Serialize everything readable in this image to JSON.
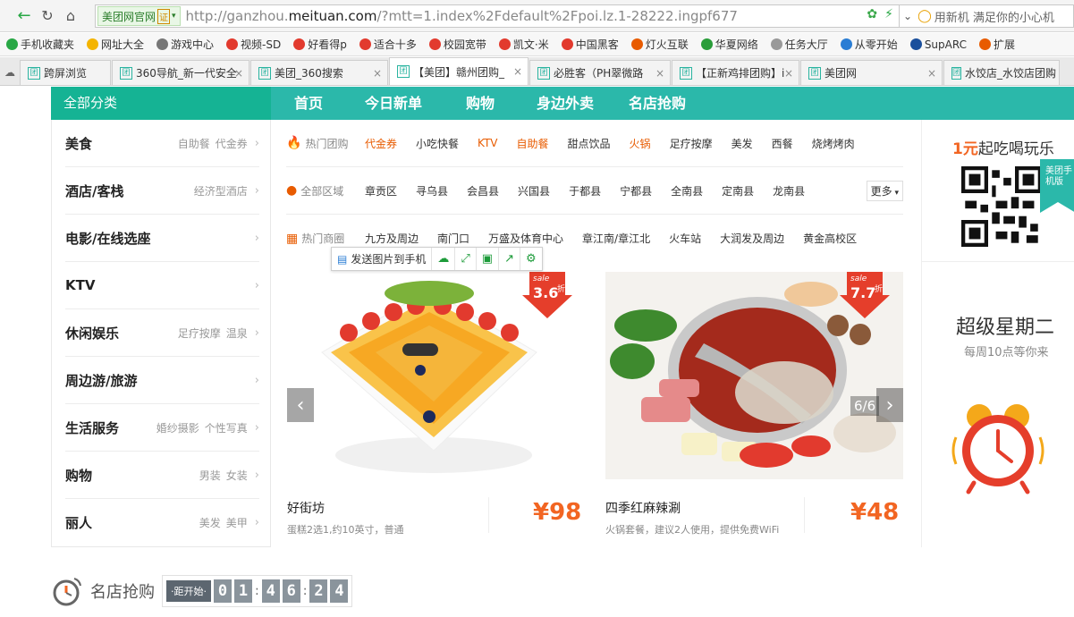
{
  "browser": {
    "site_badge": "美团网官网",
    "verify_badge": "证",
    "url_prefix": "http://ganzhou.",
    "url_domain": "meituan.com",
    "url_suffix": "/?mtt=1.index%2Fdefault%2Fpoi.lz.1-28222.ingpf677",
    "search_placeholder": "用新机 满足你的小心机",
    "bookmarks": [
      "手机收藏夹",
      "网址大全",
      "游戏中心",
      "视频-SD",
      "好看得p",
      "适合十多",
      "校园宽带",
      "凯文·米",
      "中国黑客",
      "灯火互联",
      "华夏网络",
      "任务大厅",
      "从零开始",
      "SupARC",
      "扩展"
    ],
    "tabs": [
      {
        "label": "跨屏浏览",
        "active": false
      },
      {
        "label": "360导航_新一代安全",
        "active": false
      },
      {
        "label": "美团_360搜索",
        "active": false
      },
      {
        "label": "【美团】赣州团购_",
        "active": true
      },
      {
        "label": "必胜客（PH翠微路",
        "active": false
      },
      {
        "label": "【正新鸡排团购】i",
        "active": false
      },
      {
        "label": "美团网",
        "active": false
      },
      {
        "label": "水饺店_水饺店团购",
        "active": false
      }
    ]
  },
  "nav": {
    "category_head": "全部分类",
    "items": [
      "首页",
      "今日新单",
      "购物",
      "身边外卖",
      "名店抢购"
    ]
  },
  "sidebar": {
    "items": [
      {
        "title": "美食",
        "subs": [
          "自助餐",
          "代金券"
        ]
      },
      {
        "title": "酒店/客栈",
        "subs": [
          "经济型酒店"
        ]
      },
      {
        "title": "电影/在线选座",
        "subs": []
      },
      {
        "title": "KTV",
        "subs": []
      },
      {
        "title": "休闲娱乐",
        "subs": [
          "足疗按摩",
          "温泉"
        ]
      },
      {
        "title": "周边游/旅游",
        "subs": []
      },
      {
        "title": "生活服务",
        "subs": [
          "婚纱摄影",
          "个性写真"
        ]
      },
      {
        "title": "购物",
        "subs": [
          "男装",
          "女装"
        ]
      },
      {
        "title": "丽人",
        "subs": [
          "美发",
          "美甲"
        ]
      }
    ]
  },
  "filters": {
    "hot_label": "热门团购",
    "hot_items": [
      {
        "text": "代金券",
        "hot": true
      },
      {
        "text": "小吃快餐",
        "hot": false
      },
      {
        "text": "KTV",
        "hot": true
      },
      {
        "text": "自助餐",
        "hot": true
      },
      {
        "text": "甜点饮品",
        "hot": false
      },
      {
        "text": "火锅",
        "hot": true
      },
      {
        "text": "足疗按摩",
        "hot": false
      },
      {
        "text": "美发",
        "hot": false
      },
      {
        "text": "西餐",
        "hot": false
      },
      {
        "text": "烧烤烤肉",
        "hot": false
      }
    ],
    "area_label": "全部区域",
    "area_items": [
      "章贡区",
      "寻乌县",
      "会昌县",
      "兴国县",
      "于都县",
      "宁都县",
      "全南县",
      "定南县",
      "龙南县"
    ],
    "more_label": "更多",
    "biz_label": "热门商圈",
    "biz_items": [
      "九方及周边",
      "南门口",
      "万盛及体育中心",
      "章江南/章江北",
      "火车站",
      "大润发及周边",
      "黄金高校区"
    ]
  },
  "image_toolbar": {
    "send_label": "发送图片到手机"
  },
  "deals": [
    {
      "name": "好街坊",
      "desc": "蛋糕2选1,约10英寸，普通",
      "price": "¥98",
      "sale_word": "sale",
      "discount": "3.6",
      "unit": "折"
    },
    {
      "name": "四季红麻辣涮",
      "desc": "火锅套餐，建议2人使用，提供免费WiFi",
      "price": "¥48",
      "sale_word": "sale",
      "discount": "7.7",
      "unit": "折"
    }
  ],
  "slider": {
    "page": "6/6"
  },
  "right_panel": {
    "promo_highlight": "1元",
    "promo_rest": "起吃喝玩乐",
    "ribbon_text": "美团手机版",
    "super_title": "超级星期二",
    "super_sub": "每周10点等你来"
  },
  "flash_sale": {
    "title": "名店抢购",
    "countdown_label": "·距开始·",
    "digits": [
      "0",
      "1",
      "4",
      "6",
      "2",
      "4"
    ]
  },
  "colors": {
    "brand_teal": "#2bb8aa",
    "category_green": "#15b394",
    "price_orange": "#f26522",
    "sale_red": "#e53e2b"
  }
}
